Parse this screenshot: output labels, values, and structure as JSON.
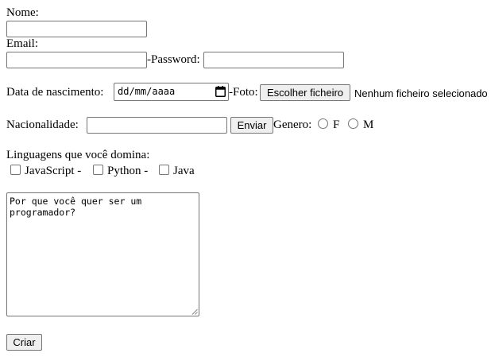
{
  "form": {
    "nome_label": "Nome:",
    "email_label": "Email:",
    "password_label": "-Password:",
    "birth_label": "Data de nascimento:",
    "birth_placeholder": "dd/mm/aaaa",
    "foto_label": "-Foto:",
    "file_button": "Escolher ficheiro",
    "file_status": "Nenhum ficheiro selecionado",
    "nationality_label": "Nacionalidade:",
    "send_button": "Enviar",
    "gender_label": "Genero:",
    "gender_options": [
      "F",
      "M"
    ],
    "languages_label": "Linguagens que você domina:",
    "languages": [
      "JavaScript -",
      "Python -",
      "Java"
    ],
    "textarea_placeholder": "Por que você quer ser um programador?",
    "create_button": "Criar"
  }
}
